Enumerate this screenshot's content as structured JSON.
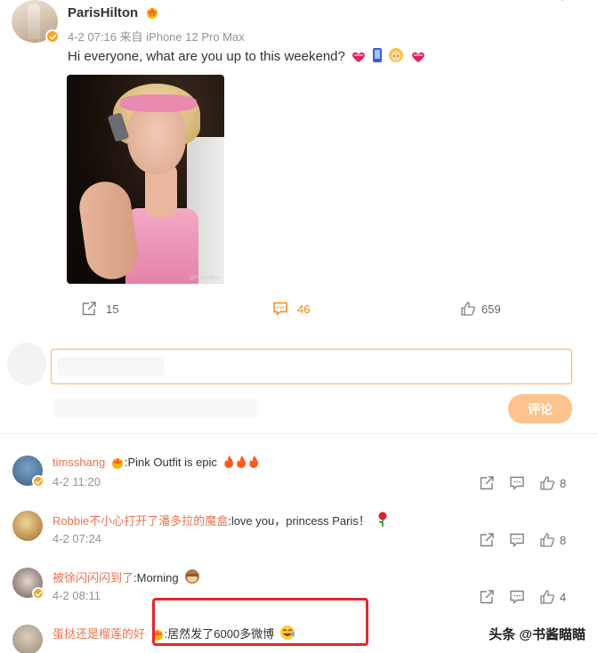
{
  "post": {
    "author": "ParisHilton",
    "meta": "4-2 07:16 来自 iPhone 12 Pro Max",
    "text": "Hi everyone, what are you up to this weekend?",
    "image_watermark": "@ParisHilton",
    "actions": {
      "share_count": "15",
      "comment_count": "46",
      "like_count": "659"
    }
  },
  "composer": {
    "submit_label": "评论"
  },
  "comments": [
    {
      "user": "timsshang",
      "text": ":Pink Outfit is epic",
      "time": "4-2 11:20",
      "likes": "8"
    },
    {
      "user": "Robbie不小心打开了潘多拉的魔盒",
      "text": ":love you，princess Paris！",
      "time": "4-2 07:24",
      "likes": "8"
    },
    {
      "user": "被徐闪闪闪到了",
      "text": ":Morning",
      "time": "4-2 08:11",
      "likes": "4"
    },
    {
      "user": "蛋挞还是榴莲的好",
      "text": ":居然发了6000多微博",
      "time": "",
      "likes": ""
    }
  ],
  "watermark": "头条 @书酱瞄瞄",
  "colors": {
    "accent_orange": "#ff8200",
    "username_orange": "#eb7350",
    "submit_bg": "#fcc48c",
    "highlight_red": "#e5272d",
    "verified_gold": "#f5a623"
  },
  "icons": [
    "share-icon",
    "comment-icon",
    "like-icon",
    "verified-icon",
    "crown-icon",
    "fire-icon",
    "rose-icon",
    "monkey-icon",
    "laugh-icon"
  ]
}
